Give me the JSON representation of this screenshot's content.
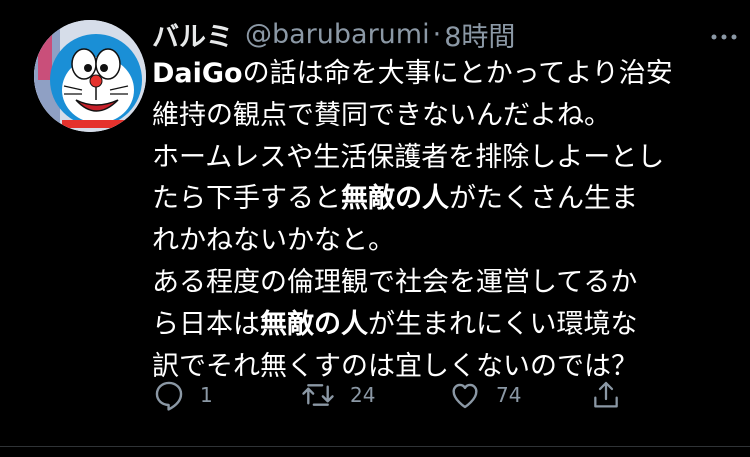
{
  "tweet": {
    "display_name": "バルミ",
    "handle": "@barubarumi",
    "separator": "·",
    "time": "8時間",
    "lines": [
      [
        {
          "t": "DaiGo",
          "b": true
        },
        {
          "t": "の話は命を大事にとかってより治安",
          "b": false
        }
      ],
      [
        {
          "t": "維持の観点で賛同できないんだよね。",
          "b": false
        }
      ],
      [
        {
          "t": "ホームレスや生活保護者を排除しよーとし",
          "b": false
        }
      ],
      [
        {
          "t": "たら下手すると",
          "b": false
        },
        {
          "t": "無敵の人",
          "b": true
        },
        {
          "t": "がたくさん生ま",
          "b": false
        }
      ],
      [
        {
          "t": "れかねないかなと。",
          "b": false
        }
      ],
      [
        {
          "t": "ある程度の倫理観で社会を運営してるか",
          "b": false
        }
      ],
      [
        {
          "t": "ら日本は",
          "b": false
        },
        {
          "t": "無敵の人",
          "b": true
        },
        {
          "t": "が生まれにくい環境な",
          "b": false
        }
      ],
      [
        {
          "t": "訳でそれ無くすのは宜しくないのでは？",
          "b": false
        }
      ]
    ]
  },
  "actions": {
    "reply": {
      "icon": "reply-icon",
      "count": "1"
    },
    "retweet": {
      "icon": "retweet-icon",
      "count": "24"
    },
    "like": {
      "icon": "heart-icon",
      "count": "74"
    },
    "share": {
      "icon": "share-icon"
    }
  },
  "colors": {
    "background": "#000000",
    "text": "#ffffff",
    "secondary": "#8b98a5",
    "divider": "#2f3336"
  }
}
